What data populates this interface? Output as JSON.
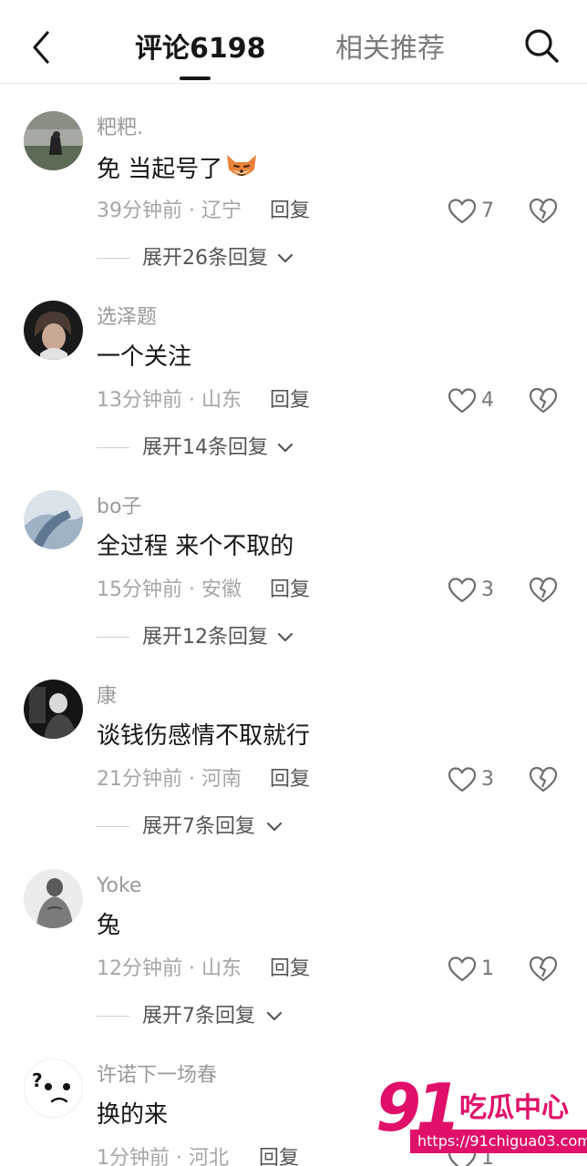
{
  "header": {
    "tab_comments": "评论6198",
    "tab_related": "相关推荐"
  },
  "icons": {
    "back": "chevron-left-icon",
    "search": "search-icon",
    "like": "heart-outline-icon",
    "dislike": "broken-heart-icon",
    "expand": "chevron-down-icon"
  },
  "comments": [
    {
      "username": "粑粑.",
      "text": "免 当起号了",
      "has_emoji": true,
      "time_location": "39分钟前 · 辽宁",
      "reply": "回复",
      "likes": "7",
      "expand": "展开26条回复"
    },
    {
      "username": "选泽题",
      "text": "一个关注",
      "time_location": "13分钟前 · 山东",
      "reply": "回复",
      "likes": "4",
      "expand": "展开14条回复"
    },
    {
      "username": "bo子",
      "text": "全过程 来个不取的",
      "time_location": "15分钟前 · 安徽",
      "reply": "回复",
      "likes": "3",
      "expand": "展开12条回复"
    },
    {
      "username": "康",
      "text": "谈钱伤感情不取就行",
      "time_location": "21分钟前 · 河南",
      "reply": "回复",
      "likes": "3",
      "expand": "展开7条回复"
    },
    {
      "username": "Yoke",
      "text": "兔",
      "time_location": "12分钟前 · 山东",
      "reply": "回复",
      "likes": "1",
      "expand": "展开7条回复"
    },
    {
      "username": "许诺下一场春",
      "text": "换的来",
      "time_location": "1分钟前 · 河北",
      "reply": "回复",
      "likes": "1",
      "expand": ""
    }
  ],
  "watermark": {
    "number": "91",
    "title": "吃瓜中心",
    "url": "https://91chigua03.com"
  },
  "colors": {
    "accent": "#e0106a",
    "text": "#161616",
    "muted": "#a6a6a6"
  }
}
